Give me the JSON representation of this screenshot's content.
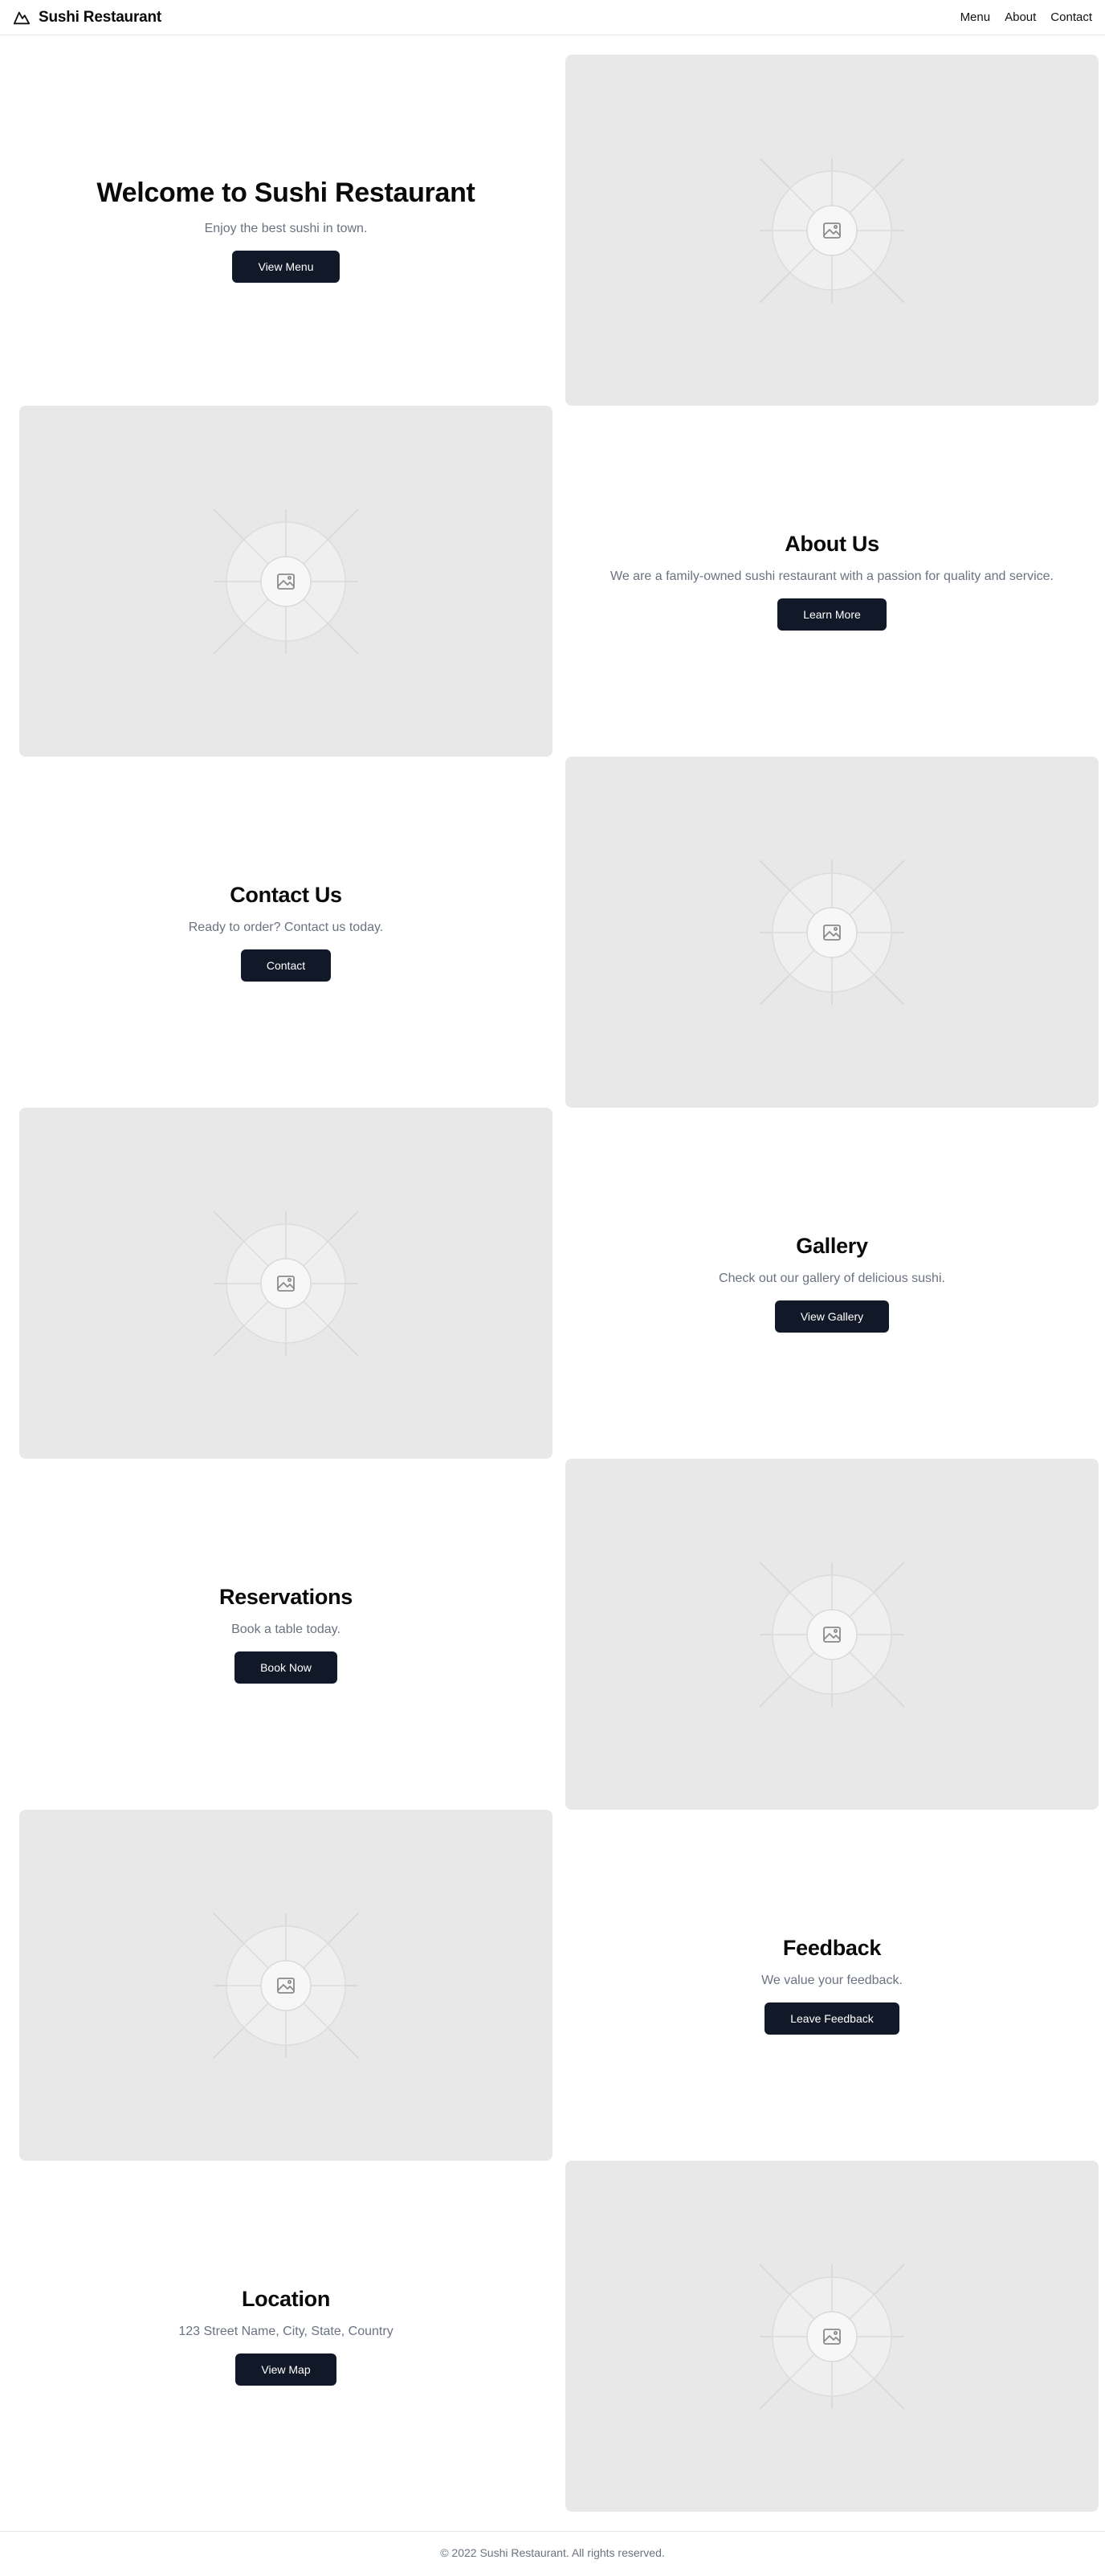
{
  "header": {
    "brand": "Sushi Restaurant",
    "logo_icon": "mountain-icon",
    "nav": [
      {
        "label": "Menu"
      },
      {
        "label": "About"
      },
      {
        "label": "Contact"
      }
    ]
  },
  "sections": [
    {
      "title": "Welcome to Sushi Restaurant",
      "description": "Enjoy the best sushi in town.",
      "button": "View Menu"
    },
    {
      "title": "About Us",
      "description": "We are a family-owned sushi restaurant with a passion for quality and service.",
      "button": "Learn More"
    },
    {
      "title": "Contact Us",
      "description": "Ready to order? Contact us today.",
      "button": "Contact"
    },
    {
      "title": "Gallery",
      "description": "Check out our gallery of delicious sushi.",
      "button": "View Gallery"
    },
    {
      "title": "Reservations",
      "description": "Book a table today.",
      "button": "Book Now"
    },
    {
      "title": "Feedback",
      "description": "We value your feedback.",
      "button": "Leave Feedback"
    },
    {
      "title": "Location",
      "description": "123 Street Name, City, State, Country",
      "button": "View Map"
    }
  ],
  "placeholder_icon": "image-placeholder-icon",
  "footer": {
    "copyright": "© 2022 Sushi Restaurant. All rights reserved."
  },
  "colors": {
    "button_bg": "#111827",
    "placeholder_bg": "#e8e8e8",
    "muted_text": "#6b7280"
  }
}
